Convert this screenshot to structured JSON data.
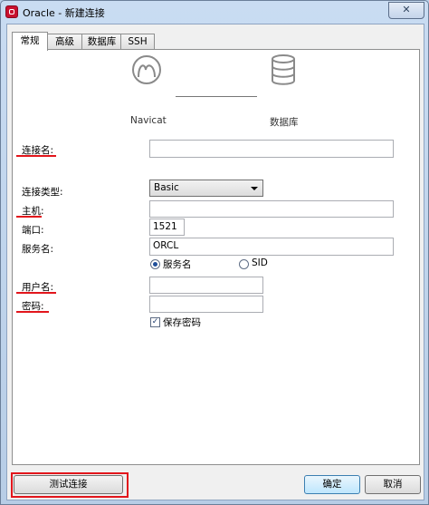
{
  "window": {
    "title": "Oracle - 新建连接",
    "close_symbol": "✕"
  },
  "tabs": [
    {
      "label": "常规",
      "active": true
    },
    {
      "label": "高级",
      "active": false
    },
    {
      "label": "数据库",
      "active": false
    },
    {
      "label": "SSH",
      "active": false
    }
  ],
  "diagram": {
    "left_label": "Navicat",
    "right_label": "数据库",
    "left_icon": "navicat-logo-icon",
    "right_icon": "database-icon"
  },
  "form": {
    "connection_name": {
      "label": "连接名:",
      "value": ""
    },
    "connection_type": {
      "label": "连接类型:",
      "value": "Basic"
    },
    "host": {
      "label": "主机:",
      "value": ""
    },
    "port": {
      "label": "端口:",
      "value": "1521"
    },
    "service_name": {
      "label": "服务名:",
      "value": "ORCL"
    },
    "radio_service": {
      "label": "服务名",
      "selected": true
    },
    "radio_sid": {
      "label": "SID",
      "selected": false
    },
    "username": {
      "label": "用户名:",
      "value": ""
    },
    "password": {
      "label": "密码:",
      "value": ""
    },
    "save_password": {
      "label": "保存密码",
      "checked": true
    }
  },
  "buttons": {
    "test_connection": "测试连接",
    "ok": "确定",
    "cancel": "取消"
  },
  "annotation_color": "#e2161c"
}
